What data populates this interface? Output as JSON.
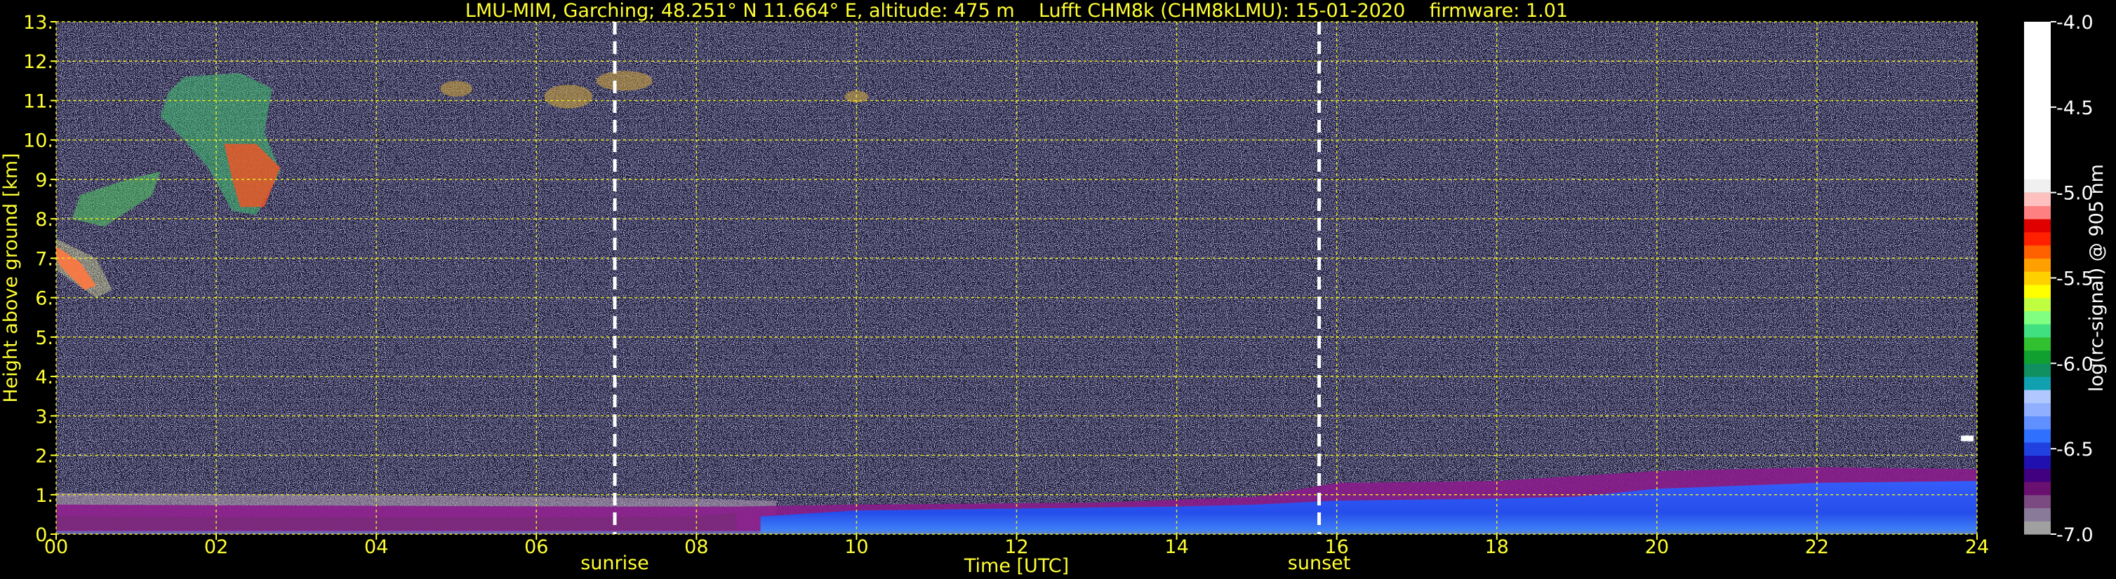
{
  "chart_data": {
    "type": "heatmap",
    "title": "LMU-MIM, Garching; 48.251° N 11.664° E, altitude: 475 m    Lufft CHM8k (CHM8kLMU): 15-01-2020    firmware: 1.01",
    "xlabel": "Time [UTC]",
    "ylabel": "Height above ground [km]",
    "xlim": [
      0,
      24
    ],
    "ylim": [
      0,
      13
    ],
    "x_ticks": [
      "00",
      "02",
      "04",
      "06",
      "08",
      "10",
      "12",
      "14",
      "16",
      "18",
      "20",
      "22",
      "24"
    ],
    "y_ticks": [
      "0.",
      "1.",
      "2.",
      "3.",
      "4.",
      "5.",
      "6.",
      "7.",
      "8.",
      "9.",
      "10.",
      "11.",
      "12.",
      "13."
    ],
    "grid": true,
    "vertical_markers": [
      {
        "label": "sunrise",
        "x": 6.98
      },
      {
        "label": "sunset",
        "x": 15.78
      }
    ],
    "colorbar": {
      "label": "log(rc-signal) @ 905 nm",
      "range": [
        -7.0,
        -4.0
      ],
      "ticks": [
        "-4.0",
        "-4.5",
        "-5.0",
        "-5.5",
        "-6.0",
        "-6.5",
        "-7.0"
      ],
      "colors": [
        "#a0a0a0",
        "#8a7a9a",
        "#7a4a80",
        "#6a1070",
        "#400080",
        "#2010b0",
        "#2040e0",
        "#3070ff",
        "#6090ff",
        "#90b0ff",
        "#b0c8ff",
        "#10a0b0",
        "#109060",
        "#10a030",
        "#30c030",
        "#40e080",
        "#80ff80",
        "#c0ff40",
        "#ffff00",
        "#ffd000",
        "#ffa000",
        "#ff6000",
        "#ff2000",
        "#e00000",
        "#ff8080",
        "#ffc0c0",
        "#f0f0f0",
        "#ffffff"
      ]
    }
  }
}
